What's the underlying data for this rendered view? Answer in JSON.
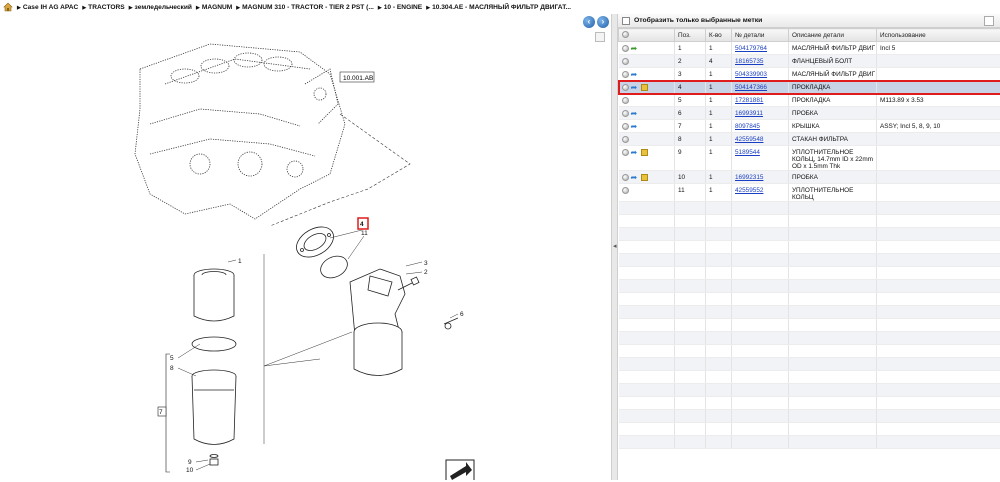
{
  "breadcrumb": [
    "Case IH AG APAC",
    "TRACTORS",
    "земледельческий",
    "MAGNUM",
    "MAGNUM 310 - TRACTOR - TIER 2 PST (...",
    "10 - ENGINE",
    "10.304.AE - МАСЛЯНЫЙ ФИЛЬТР ДВИГАТ..."
  ],
  "drawing": {
    "ref_label": "10.001.AB",
    "callouts": [
      "1",
      "2",
      "3",
      "4",
      "5",
      "6",
      "7",
      "8",
      "9",
      "10",
      "11"
    ]
  },
  "filter": {
    "label": "Отобразить только выбранные метки"
  },
  "columns": [
    "Поз.",
    "К-во",
    "№ детали",
    "Описание детали",
    "Использование"
  ],
  "rows": [
    {
      "pos": "1",
      "qty": "1",
      "part": "504179764",
      "desc": "МАСЛЯНЫЙ ФИЛЬТР ДВИГ",
      "usage": "Incl 5",
      "icons": [
        "green-arrow"
      ]
    },
    {
      "pos": "2",
      "qty": "4",
      "part": "18165735",
      "desc": "ФЛАНЦЕВЫЙ БОЛТ",
      "usage": "",
      "icons": []
    },
    {
      "pos": "3",
      "qty": "1",
      "part": "504339903",
      "desc": "МАСЛЯНЫЙ ФИЛЬТР ДВИГ",
      "usage": "",
      "icons": [
        "share"
      ]
    },
    {
      "pos": "4",
      "qty": "1",
      "part": "504147366",
      "desc": "ПРОКЛАДКА",
      "usage": "",
      "icons": [
        "share",
        "box"
      ],
      "selected": true
    },
    {
      "pos": "5",
      "qty": "1",
      "part": "17281881",
      "desc": "ПРОКЛАДКА",
      "usage": "M113.89 x 3.53",
      "icons": []
    },
    {
      "pos": "6",
      "qty": "1",
      "part": "16993911",
      "desc": "ПРОБКА",
      "usage": "",
      "icons": [
        "share"
      ]
    },
    {
      "pos": "7",
      "qty": "1",
      "part": "8097845",
      "desc": "КРЫШКА",
      "usage": "ASSY; Incl 5, 8, 9, 10",
      "icons": [
        "share"
      ]
    },
    {
      "pos": "8",
      "qty": "1",
      "part": "42559548",
      "desc": "СТАКАН ФИЛЬТРА",
      "usage": "",
      "icons": []
    },
    {
      "pos": "9",
      "qty": "1",
      "part": "5189544",
      "desc": "УПЛОТНИТЕЛЬНОЕ КОЛЬЦ, 14.7mm ID x 22mm OD x 1.5mm Thk",
      "usage": "",
      "icons": [
        "share",
        "box"
      ]
    },
    {
      "pos": "10",
      "qty": "1",
      "part": "16992315",
      "desc": "ПРОБКА",
      "usage": "",
      "icons": [
        "share",
        "box"
      ]
    },
    {
      "pos": "11",
      "qty": "1",
      "part": "42559552",
      "desc": "УПЛОТНИТЕЛЬНОЕ КОЛЬЦ",
      "usage": "",
      "icons": []
    }
  ],
  "colors": {
    "selected_row": "#c9d3e6",
    "highlight_border": "#e01b1b",
    "link": "#1a3fc2"
  }
}
